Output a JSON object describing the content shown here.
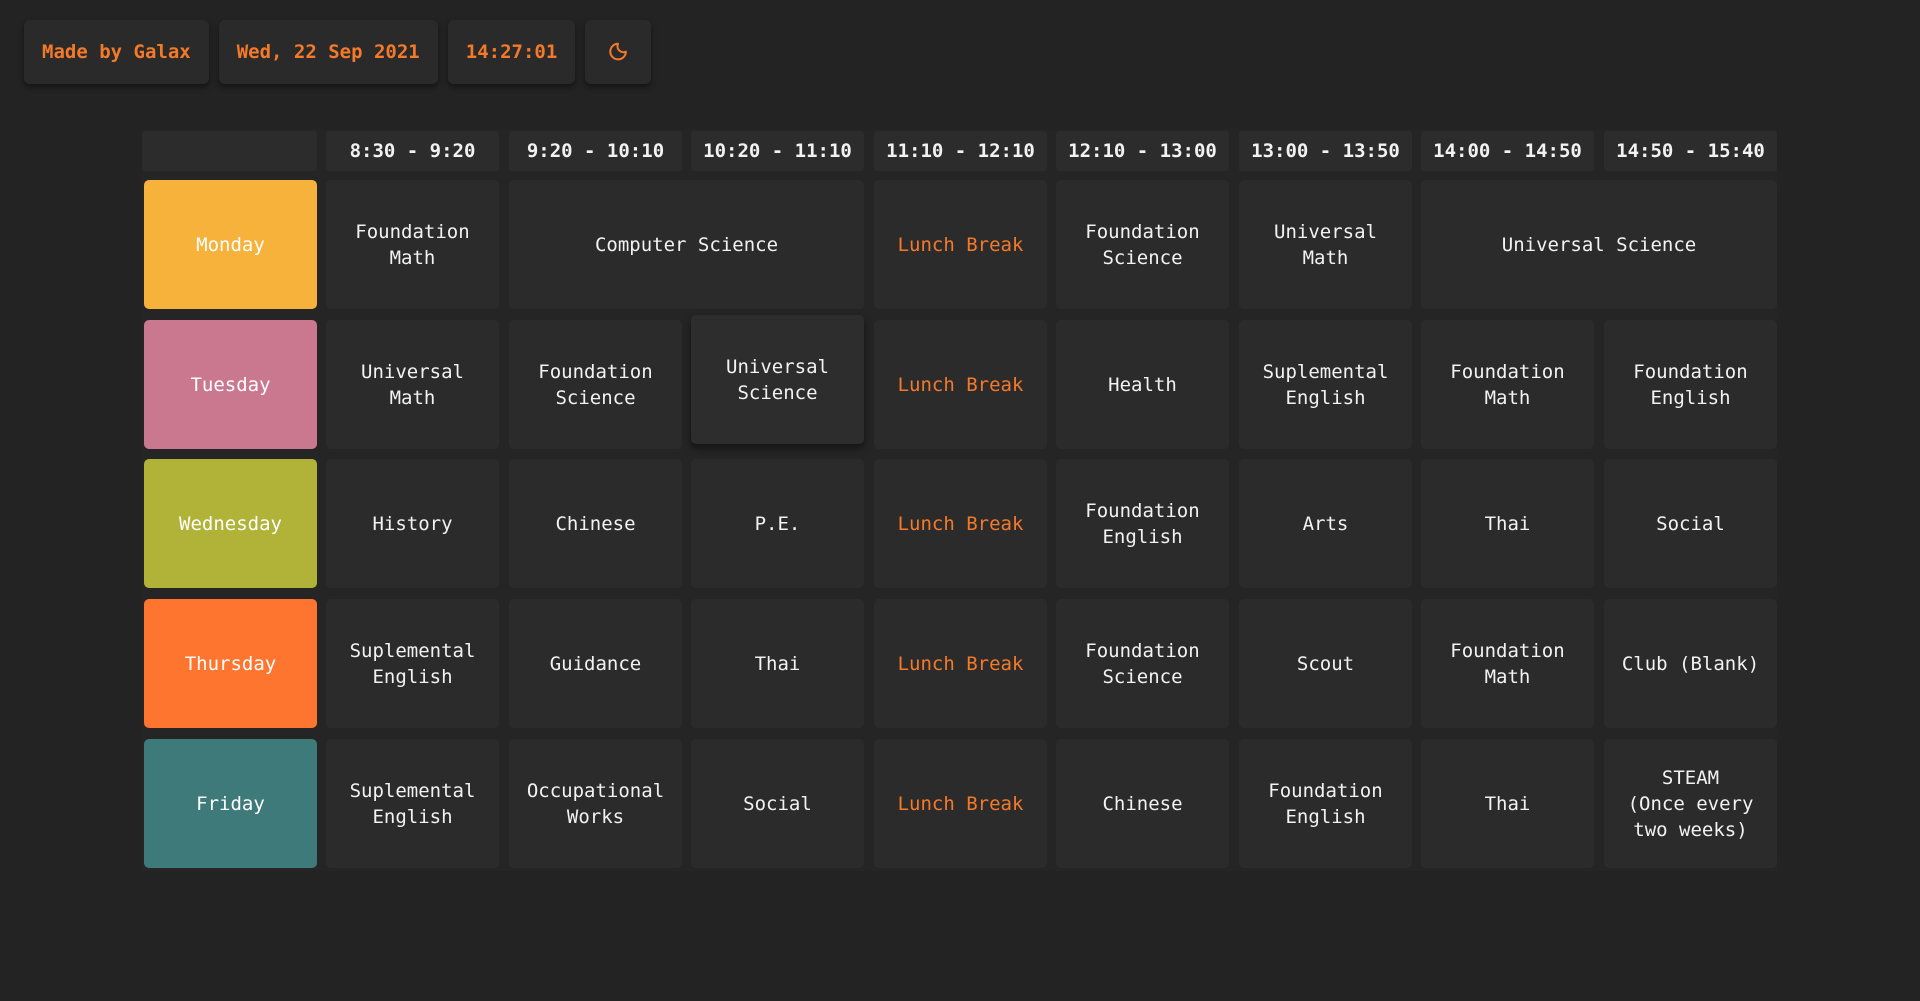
{
  "topbar": {
    "credit": "Made by Galax",
    "date": "Wed, 22 Sep 2021",
    "time": "14:27:01",
    "theme_icon": "moon-icon"
  },
  "colors": {
    "accent": "#f47a2a",
    "background": "#232323",
    "cell": "#2c2b2c",
    "monday": "#f7b23b",
    "tuesday": "#ca788f",
    "wednesday": "#b1b338",
    "thursday": "#fe7530",
    "friday": "#3e7a7a"
  },
  "timetable": {
    "periods": [
      "8:30 - 9:20",
      "9:20 - 10:10",
      "10:20 - 11:10",
      "11:10 - 12:10",
      "12:10 - 13:00",
      "13:00 - 13:50",
      "14:00 - 14:50",
      "14:50 - 15:40"
    ],
    "days": [
      {
        "name": "Monday",
        "color": "#f7b23b",
        "classes": [
          {
            "label": "Foundation\nMath",
            "span": 1
          },
          {
            "label": "Computer Science",
            "span": 2
          },
          {
            "label": "Lunch Break",
            "span": 1,
            "lunch": true
          },
          {
            "label": "Foundation\nScience",
            "span": 1
          },
          {
            "label": "Universal\nMath",
            "span": 1
          },
          {
            "label": "Universal Science",
            "span": 2
          }
        ]
      },
      {
        "name": "Tuesday",
        "color": "#ca788f",
        "classes": [
          {
            "label": "Universal\nMath",
            "span": 1
          },
          {
            "label": "Foundation\nScience",
            "span": 1
          },
          {
            "label": "Universal\nScience",
            "span": 1,
            "current": true
          },
          {
            "label": "Lunch Break",
            "span": 1,
            "lunch": true
          },
          {
            "label": "Health",
            "span": 1
          },
          {
            "label": "Suplemental\nEnglish",
            "span": 1
          },
          {
            "label": "Foundation\nMath",
            "span": 1
          },
          {
            "label": "Foundation\nEnglish",
            "span": 1
          }
        ]
      },
      {
        "name": "Wednesday",
        "color": "#b1b338",
        "classes": [
          {
            "label": "History",
            "span": 1
          },
          {
            "label": "Chinese",
            "span": 1
          },
          {
            "label": "P.E.",
            "span": 1
          },
          {
            "label": "Lunch Break",
            "span": 1,
            "lunch": true
          },
          {
            "label": "Foundation\nEnglish",
            "span": 1
          },
          {
            "label": "Arts",
            "span": 1
          },
          {
            "label": "Thai",
            "span": 1
          },
          {
            "label": "Social",
            "span": 1
          }
        ]
      },
      {
        "name": "Thursday",
        "color": "#fe7530",
        "classes": [
          {
            "label": "Suplemental\nEnglish",
            "span": 1
          },
          {
            "label": "Guidance",
            "span": 1
          },
          {
            "label": "Thai",
            "span": 1
          },
          {
            "label": "Lunch Break",
            "span": 1,
            "lunch": true
          },
          {
            "label": "Foundation\nScience",
            "span": 1
          },
          {
            "label": "Scout",
            "span": 1
          },
          {
            "label": "Foundation\nMath",
            "span": 1
          },
          {
            "label": "Club (Blank)",
            "span": 1
          }
        ]
      },
      {
        "name": "Friday",
        "color": "#3e7a7a",
        "classes": [
          {
            "label": "Suplemental\nEnglish",
            "span": 1
          },
          {
            "label": "Occupational\nWorks",
            "span": 1
          },
          {
            "label": "Social",
            "span": 1
          },
          {
            "label": "Lunch Break",
            "span": 1,
            "lunch": true
          },
          {
            "label": "Chinese",
            "span": 1
          },
          {
            "label": "Foundation\nEnglish",
            "span": 1
          },
          {
            "label": "Thai",
            "span": 1
          },
          {
            "label": "STEAM\n(Once every\ntwo weeks)",
            "span": 1
          }
        ]
      }
    ]
  }
}
